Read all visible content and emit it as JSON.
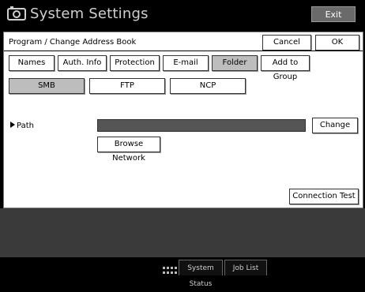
{
  "window": {
    "title": "System Settings",
    "exit_label": "Exit"
  },
  "screen": {
    "title": "Program / Change Address Book",
    "cancel_label": "Cancel",
    "ok_label": "OK"
  },
  "tabs": [
    {
      "label": "Names",
      "active": false
    },
    {
      "label": "Auth. Info",
      "active": false
    },
    {
      "label": "Protection",
      "active": false
    },
    {
      "label": "E-mail",
      "active": false
    },
    {
      "label": "Folder",
      "active": true
    },
    {
      "label": "Add to Group",
      "active": false
    }
  ],
  "protocols": [
    {
      "label": "SMB",
      "active": true
    },
    {
      "label": "FTP",
      "active": false
    },
    {
      "label": "NCP",
      "active": false
    }
  ],
  "path": {
    "label": "Path",
    "value": "",
    "change_label": "Change",
    "browse_label": "Browse Network"
  },
  "connection_test_label": "Connection Test",
  "status_bar": {
    "system_status_label": "System Status",
    "job_list_label": "Job List"
  },
  "colors": {
    "active_tab": "#bdbdbd",
    "path_field": "#555555",
    "footer": "#3a3a3a"
  },
  "icons": {
    "title": "settings-icon",
    "status": "status-indicator-icon"
  }
}
